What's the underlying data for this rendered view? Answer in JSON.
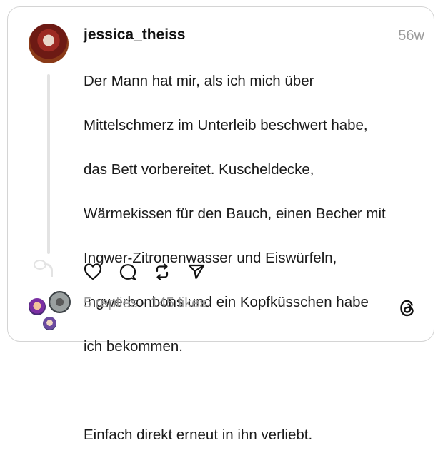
{
  "post": {
    "username": "jessica_theiss",
    "timestamp": "56w",
    "lines": [
      "Der Mann hat mir, als ich mich über",
      "Mittelschmerz im Unterleib beschwert habe,",
      "das Bett vorbereitet. Kuscheldecke,",
      "Wärmekissen für den Bauch, einen Becher mit",
      "Ingwer-Zitronenwasser und Eiswürfeln,",
      "Ingwerbonbons und ein Kopfküsschen habe",
      "ich bekommen.",
      "",
      "Einfach direkt erneut in ihn verliebt."
    ],
    "replies": "5 replies",
    "separator": "·",
    "likes": "145 likes"
  },
  "icons": {
    "like": "heart-icon",
    "reply": "comment-icon",
    "repost": "repost-icon",
    "share": "send-icon",
    "brand": "threads-logo-icon"
  },
  "colors": {
    "text": "#1a1a1a",
    "muted": "#9b9b9b",
    "border": "#d4d4d4",
    "thread_line": "#e3e3e3"
  }
}
